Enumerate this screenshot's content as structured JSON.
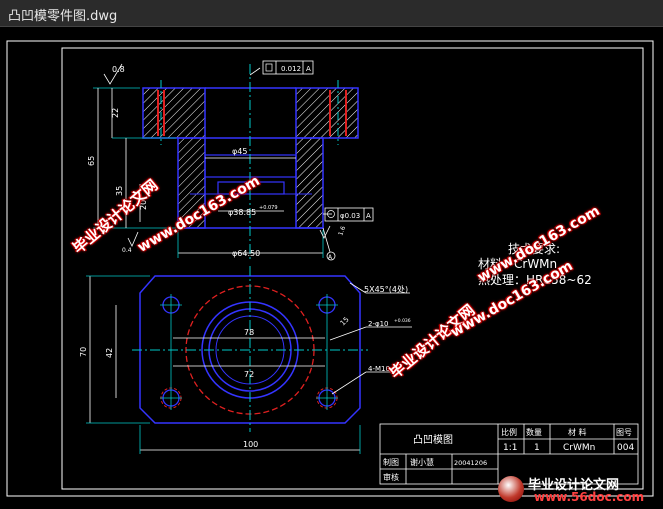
{
  "window": {
    "title": "凸凹模零件图.dwg"
  },
  "drawing": {
    "dims": {
      "roughness": "0.8",
      "dim_22": "22",
      "dim_65": "65",
      "dim_35": "35",
      "dim_20": "20",
      "dia_45": "φ45",
      "dia_38": "φ38.85",
      "dia_38_tol": "+0.079",
      "dia_64": "φ64.50",
      "flat_tol": "0.012",
      "flat_ref": "A",
      "coax_tol": "φ0.03",
      "coax_ref": "A",
      "datum": "A",
      "rough_small": "0.4",
      "rough_side": "1.6",
      "chamfer": "5X45°(4处)",
      "holes_a": "2-φ10",
      "holes_a_tol": "+0.036",
      "holes_b": "4-M10",
      "dim_78": "78",
      "dim_72": "72",
      "dim_42": "42",
      "dim_70": "70",
      "dim_100": "100",
      "dim_15": "15"
    },
    "tech_req": {
      "title": "技术要求:",
      "material": "材料：CrWMn",
      "heat": "热处理：HRC58~62"
    },
    "title_block": {
      "part_name": "凸凹模图",
      "h_scale": "比例",
      "h_qty": "数量",
      "h_material": "材 料",
      "h_drawing_no": "图号",
      "scale": "1:1",
      "qty": "1",
      "material": "CrWMn",
      "drawing_no": "004",
      "drawn_by_label": "制图",
      "drawn_by": "谢小慧",
      "drawn_date": "20041206",
      "checked_by_label": "审核"
    }
  },
  "watermarks": {
    "cn1": "毕业设计论文网",
    "url1": "www.doc163.com",
    "cn2": "毕业设计论文网",
    "url2": "www.doc163.com",
    "cn3": "毕业设计论文网",
    "url3": "www.doc163.com",
    "logo_cn": "毕业设计论文网",
    "logo_url": "www.56doc.com"
  },
  "colors": {
    "outline": "#3434ff",
    "center": "#00c8c8",
    "hatch": "#e02020",
    "text": "#ffffff",
    "frame": "#ffffff"
  }
}
